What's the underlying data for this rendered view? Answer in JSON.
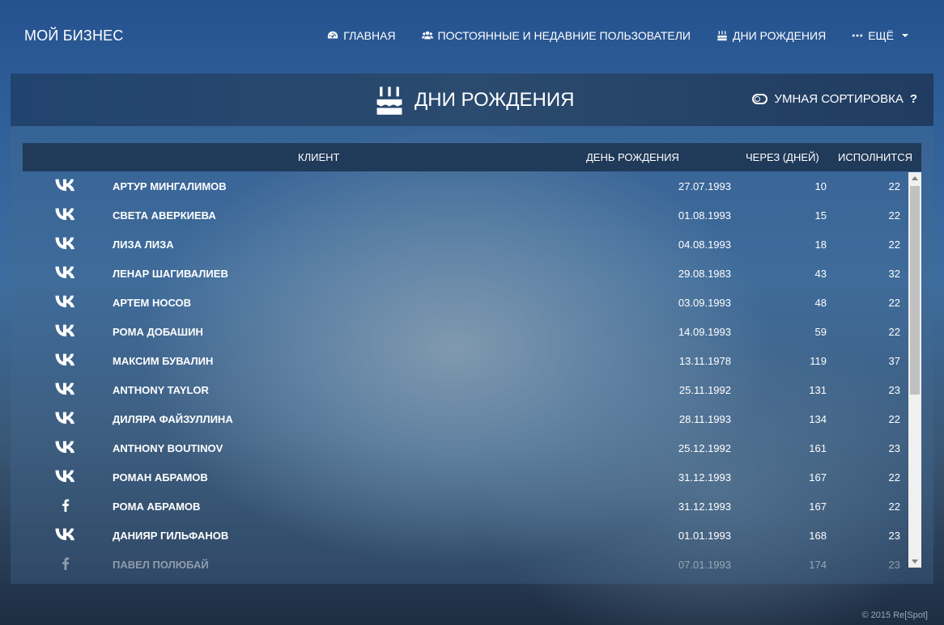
{
  "brand": "МОЙ БИЗНЕС",
  "nav": [
    {
      "label": "ГЛАВНАЯ",
      "icon": "dashboard-icon"
    },
    {
      "label": "ПОСТОЯННЫЕ И НЕДАВНИЕ ПОЛЬЗОВАТЕЛИ",
      "icon": "users-icon"
    },
    {
      "label": "ДНИ РОЖДЕНИЯ",
      "icon": "birthday-cake-icon"
    },
    {
      "label": "ЕЩЁ",
      "icon": "ellipsis-icon"
    }
  ],
  "panel": {
    "title": "ДНИ РОЖДЕНИЯ",
    "smart_sort_label": "УМНАЯ СОРТИРОВКА",
    "help": "?"
  },
  "columns": {
    "client": "КЛИЕНТ",
    "birthday": "ДЕНЬ РОЖДЕНИЯ",
    "in_days": "ЧЕРЕЗ (ДНЕЙ)",
    "turns": "ИСПОЛНИТСЯ"
  },
  "rows": [
    {
      "network": "vk",
      "name": "АРТУР МИНГАЛИМОВ",
      "date": "27.07.1993",
      "days": "10",
      "age": "22"
    },
    {
      "network": "vk",
      "name": "СВЕТА АВЕРКИЕВА",
      "date": "01.08.1993",
      "days": "15",
      "age": "22"
    },
    {
      "network": "vk",
      "name": "ЛИЗА ЛИЗА",
      "date": "04.08.1993",
      "days": "18",
      "age": "22"
    },
    {
      "network": "vk",
      "name": "ЛЕНАР ШАГИВАЛИЕВ",
      "date": "29.08.1983",
      "days": "43",
      "age": "32"
    },
    {
      "network": "vk",
      "name": "АРТЕМ НОСОВ",
      "date": "03.09.1993",
      "days": "48",
      "age": "22"
    },
    {
      "network": "vk",
      "name": "РОМА ДОБАШИН",
      "date": "14.09.1993",
      "days": "59",
      "age": "22"
    },
    {
      "network": "vk",
      "name": "МАКСИМ БУВАЛИН",
      "date": "13.11.1978",
      "days": "119",
      "age": "37"
    },
    {
      "network": "vk",
      "name": "ANTHONY TAYLOR",
      "date": "25.11.1992",
      "days": "131",
      "age": "23"
    },
    {
      "network": "vk",
      "name": "ДИЛЯРА ФАЙЗУЛЛИНА",
      "date": "28.11.1993",
      "days": "134",
      "age": "22"
    },
    {
      "network": "vk",
      "name": "ANTHONY BOUTINOV",
      "date": "25.12.1992",
      "days": "161",
      "age": "23"
    },
    {
      "network": "vk",
      "name": "РОМАН АБРАМОВ",
      "date": "31.12.1993",
      "days": "167",
      "age": "22"
    },
    {
      "network": "fb",
      "name": "РОМА АБРАМОВ",
      "date": "31.12.1993",
      "days": "167",
      "age": "22"
    },
    {
      "network": "vk",
      "name": "ДАНИЯР ГИЛЬФАНОВ",
      "date": "01.01.1993",
      "days": "168",
      "age": "23"
    },
    {
      "network": "fb",
      "name": "ПАВЕЛ ПОЛЮБАЙ",
      "date": "07.01.1993",
      "days": "174",
      "age": "23"
    }
  ],
  "footer": "© 2015 Re[Spot]"
}
